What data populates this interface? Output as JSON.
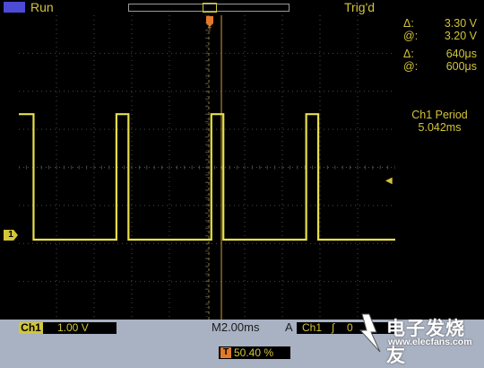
{
  "status": {
    "acquisition": "Run",
    "trigger_state": "Trig'd"
  },
  "measurements": {
    "delta_v_symbol": "Δ:",
    "delta_v_value": "3.30 V",
    "at_v_symbol": "@:",
    "at_v_value": "3.20 V",
    "delta_t_symbol": "Δ:",
    "delta_t_value": "640μs",
    "at_t_symbol": "@:",
    "at_t_value": "600μs",
    "period_label": "Ch1 Period",
    "period_value": "5.042ms"
  },
  "channel": {
    "name": "Ch1",
    "marker": "1",
    "scale": "1.00 V"
  },
  "timebase": {
    "label": "M",
    "value": "2.00ms"
  },
  "trigger": {
    "mode": "A",
    "source": "Ch1",
    "slope": "∫",
    "level": "0",
    "marker": "T",
    "position": "50.40 %"
  },
  "watermark": {
    "main": "电子发烧友",
    "sub": "www.elecfans.com"
  },
  "colors": {
    "trace": "#e7e04a",
    "ui_text": "#d2c53a",
    "trigger_marker": "#e07a2a",
    "grid": "#4a4a4a"
  },
  "waveform": {
    "type": "square",
    "high_v": 3.3,
    "low_v": 0,
    "period_ms": 5.042,
    "pulse_width_ms": 0.64
  }
}
